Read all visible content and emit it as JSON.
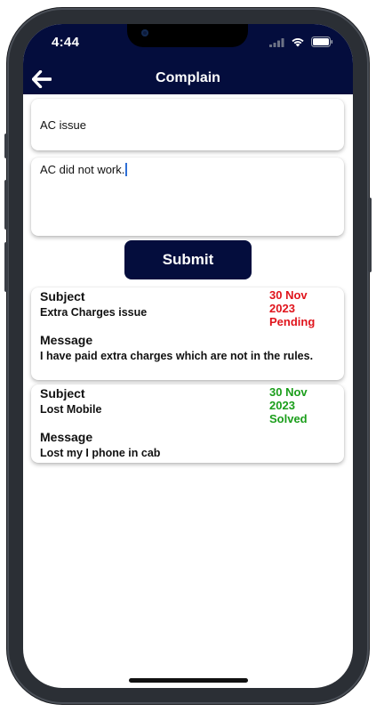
{
  "status_bar": {
    "time": "4:44"
  },
  "header": {
    "title": "Complain",
    "back_icon": "arrow-left-icon"
  },
  "form": {
    "subject_value": "AC issue",
    "message_value": "AC did not work.",
    "submit_label": "Submit"
  },
  "complaints": [
    {
      "subject_label": "Subject",
      "subject": "Extra Charges issue",
      "message_label": "Message",
      "message": "I have paid extra charges which are not in the rules.",
      "date_line1": "30 Nov",
      "date_line2": "2023",
      "status": "Pending",
      "status_color": "#e0141c"
    },
    {
      "subject_label": "Subject",
      "subject": "Lost Mobile",
      "message_label": "Message",
      "message": "Lost my I phone in cab",
      "date_line1": "30 Nov",
      "date_line2": "2023",
      "status": "Solved",
      "status_color": "#1b9e1b"
    }
  ],
  "colors": {
    "header_bg": "#040d3d",
    "button_bg": "#040d3d",
    "pending": "#e0141c",
    "solved": "#1b9e1b"
  }
}
